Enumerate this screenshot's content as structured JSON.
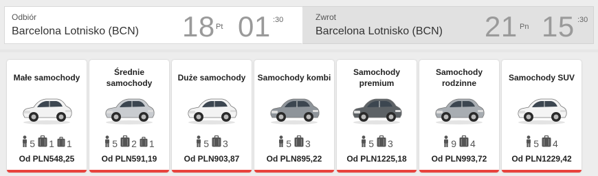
{
  "pickup": {
    "label": "Odbiór",
    "location": "Barcelona Lotnisko (BCN)",
    "day": "18",
    "weekday": "Pt",
    "hour": "01",
    "minutes": ":30"
  },
  "return": {
    "label": "Zwrot",
    "location": "Barcelona Lotnisko (BCN)",
    "day": "21",
    "weekday": "Pn",
    "hour": "15",
    "minutes": ":30"
  },
  "colors": {
    "accent": "#e8433d",
    "big_digits": "#9a9a9a"
  },
  "icons": {
    "passenger": "person-icon",
    "luggage_large": "suitcase-large-icon",
    "luggage_small": "suitcase-small-icon"
  },
  "categories": [
    {
      "title": "Małe samochody",
      "passengers": "5",
      "large_bags": "1",
      "small_bags": "1",
      "price": "Od PLN548,25",
      "car_color": "#f2f2f2"
    },
    {
      "title": "Średnie samochody",
      "passengers": "5",
      "large_bags": "2",
      "small_bags": "1",
      "price": "Od PLN591,19",
      "car_color": "#c9ccd0"
    },
    {
      "title": "Duże samochody",
      "passengers": "5",
      "large_bags": "3",
      "price": "Od PLN903,87",
      "car_color": "#f3f3f3"
    },
    {
      "title": "Samochody kombi",
      "passengers": "5",
      "large_bags": "3",
      "price": "Od PLN895,22",
      "car_color": "#8e949a"
    },
    {
      "title": "Samochody premium",
      "passengers": "5",
      "large_bags": "3",
      "price": "Od PLN1225,18",
      "car_color": "#5d6266"
    },
    {
      "title": "Samochody rodzinne",
      "passengers": "9",
      "large_bags": "4",
      "price": "Od PLN993,72",
      "car_color": "#a8adb2"
    },
    {
      "title": "Samochody SUV",
      "passengers": "5",
      "large_bags": "4",
      "price": "Od PLN1229,42",
      "car_color": "#f4f4f4"
    }
  ]
}
